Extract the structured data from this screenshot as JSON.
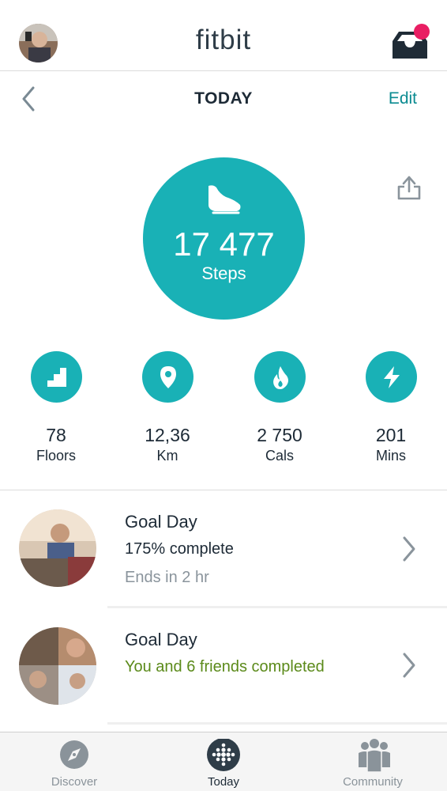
{
  "app": {
    "brand": "fitbit"
  },
  "colors": {
    "accent": "#19b1b6",
    "edit_link": "#0b8b91",
    "notification_dot": "#e91e63",
    "success_text": "#5b8a1a"
  },
  "header": {
    "title": "TODAY",
    "edit_label": "Edit"
  },
  "steps": {
    "value": "17 477",
    "label": "Steps"
  },
  "stats": [
    {
      "value": "78",
      "label": "Floors",
      "icon": "stairs-icon"
    },
    {
      "value": "12,36",
      "label": "Km",
      "icon": "location-pin-icon"
    },
    {
      "value": "2 750",
      "label": "Cals",
      "icon": "flame-icon"
    },
    {
      "value": "201",
      "label": "Mins",
      "icon": "lightning-icon"
    }
  ],
  "challenges": [
    {
      "name": "Goal Day",
      "line1": "175% complete",
      "line2": "Ends in 2 hr"
    },
    {
      "name": "Goal Day",
      "line1": "You and 6 friends completed"
    }
  ],
  "nav": {
    "tabs": [
      {
        "label": "Discover",
        "icon": "compass-icon"
      },
      {
        "label": "Today",
        "icon": "fitbit-dots-icon"
      },
      {
        "label": "Community",
        "icon": "community-people-icon"
      }
    ]
  }
}
